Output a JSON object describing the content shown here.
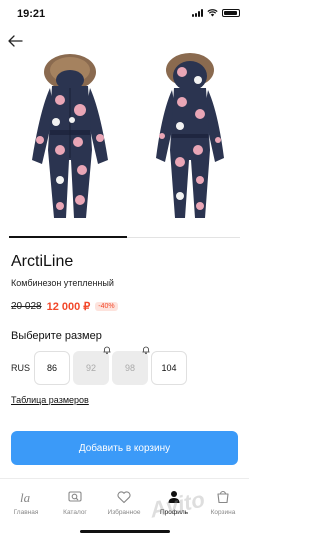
{
  "status_bar": {
    "time": "19:21"
  },
  "product": {
    "brand": "ArctiLine",
    "subtitle": "Комбинезон утепленный",
    "old_price": "20 028",
    "new_price": "12 000 ₽",
    "discount": "-40%"
  },
  "colors": {
    "accent": "#3b9af8",
    "sale": "#f2482a",
    "product_body": "#2b3450",
    "print_pink": "#e9a6b6",
    "fur": "#8a6a4f"
  },
  "sizes": {
    "title": "Выберите размер",
    "region": "RUS",
    "options": [
      {
        "label": "86",
        "available": true
      },
      {
        "label": "92",
        "available": false
      },
      {
        "label": "98",
        "available": false
      },
      {
        "label": "104",
        "available": true
      }
    ]
  },
  "size_table_link": "Таблица размеров",
  "cart_button": "Добавить в корзину",
  "gallery": {
    "active_index": 1,
    "total": 2
  },
  "tabbar": {
    "items": [
      {
        "label": "Главная",
        "icon": "home-logo-icon"
      },
      {
        "label": "Каталог",
        "icon": "catalog-search-icon"
      },
      {
        "label": "Избранное",
        "icon": "heart-icon"
      },
      {
        "label": "Профиль",
        "icon": "profile-icon"
      },
      {
        "label": "Корзина",
        "icon": "cart-icon"
      }
    ],
    "active_index": 3
  },
  "watermark": "Avito"
}
